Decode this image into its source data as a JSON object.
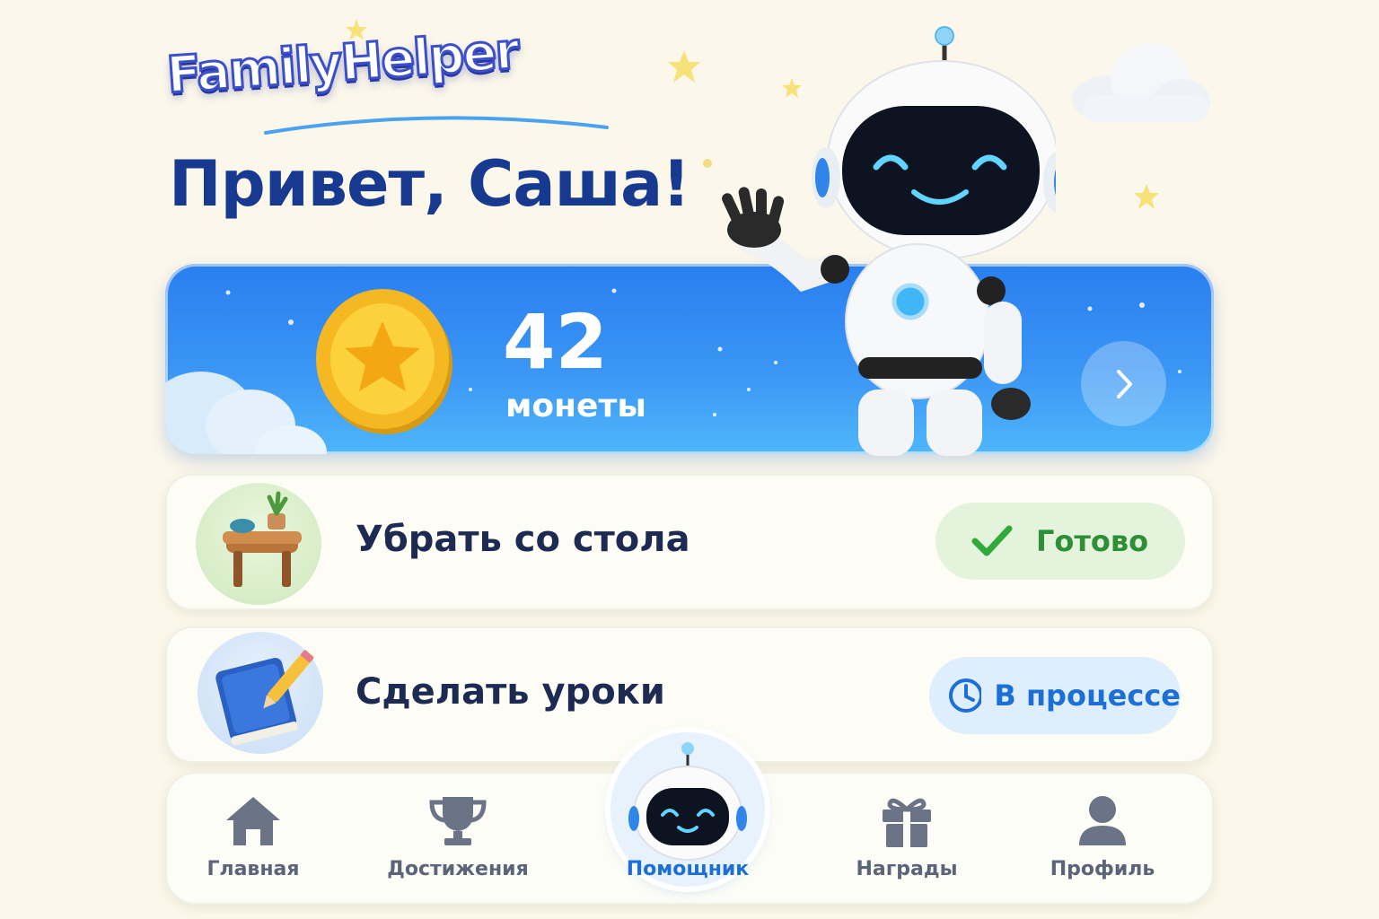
{
  "app": {
    "logo_text": "FamilyHelper"
  },
  "greeting": "Привет, Саша!",
  "balance": {
    "value": "42",
    "label": "монеты"
  },
  "tasks": [
    {
      "title": "Убрать со стола",
      "status": "Готово",
      "status_icon": "checkmark-icon",
      "icon": "table-icon"
    },
    {
      "title": "Сделать уроки",
      "status": "В процессе",
      "status_icon": "clock-icon",
      "icon": "book-pencil-icon"
    }
  ],
  "nav": {
    "items": [
      {
        "label": "Главная",
        "icon": "home-icon"
      },
      {
        "label": "Достижения",
        "icon": "trophy-icon"
      },
      {
        "label": "Помощник",
        "icon": "robot-icon",
        "active": true
      },
      {
        "label": "Награды",
        "icon": "gift-icon"
      },
      {
        "label": "Профиль",
        "icon": "user-icon"
      }
    ]
  },
  "colors": {
    "accent": "#1c6fd6",
    "banner": "#2f8cf2",
    "done": "#2f8e36",
    "heading": "#17398f"
  }
}
